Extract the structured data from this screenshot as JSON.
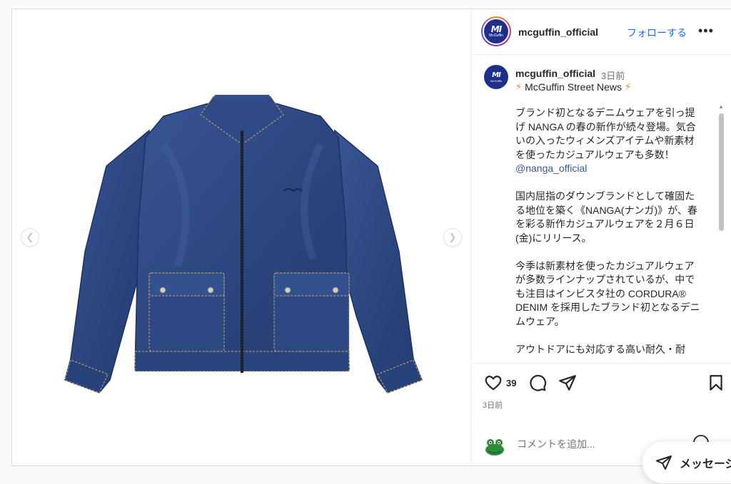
{
  "post": {
    "username": "mcguffin_official",
    "follow_label": "フォローする",
    "more_label": "•••",
    "avatar_mark": "MI",
    "avatar_word": "McGuffin"
  },
  "caption": {
    "username": "mcguffin_official",
    "time": "3日前",
    "subtitle": "McGuffin Street News",
    "paragraphs": [
      "ブランド初となるデニムウェアを引っ提げ NANGA の春の新作が続々登場。気合いの入ったウィメンズアイテムや新素材を使ったカジュアルウェアも多数！",
      "国内屈指のダウンブランドとして確固たる地位を築く《NANGA(ナンガ)》が、春を彩る新作カジュアルウェアを２月６日(金)にリリース。",
      "今季は新素材を使ったカジュアルウェアが多数ラインナップされているが、中でも注目はインビスタ社の CORDURA® DENIM を採用したブランド初となるデニムウェア。",
      "アウトドアにも対応する高い耐久・耐"
    ],
    "mention": "@nanga_official"
  },
  "actions": {
    "like_count": "39",
    "date": "3日前"
  },
  "comment": {
    "placeholder": "コメントを追加..."
  },
  "message": {
    "label": "メッセージ"
  },
  "colors": {
    "accent": "#1f6feb",
    "brand_navy": "#1f2f8c",
    "denim": "#2f4a86"
  }
}
